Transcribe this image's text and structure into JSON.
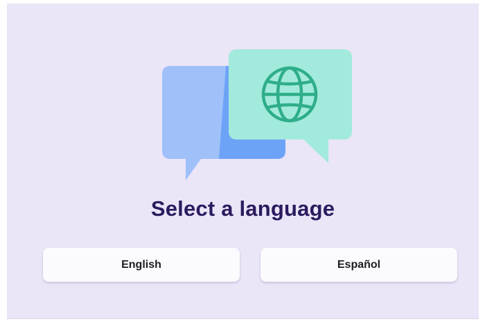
{
  "screen": {
    "title": "Select a language"
  },
  "languages": [
    {
      "label": "English"
    },
    {
      "label": "Español"
    }
  ],
  "illustration": {
    "icon": "globe-icon",
    "colors": {
      "back_bubble": "#9fc0f9",
      "back_bubble_dark": "#6da3f7",
      "front_bubble": "#a2eadc",
      "globe": "#2eae89"
    }
  },
  "colors": {
    "background": "#ebe5f8",
    "title": "#2b1b5e",
    "button_bg": "#fbfafd"
  }
}
